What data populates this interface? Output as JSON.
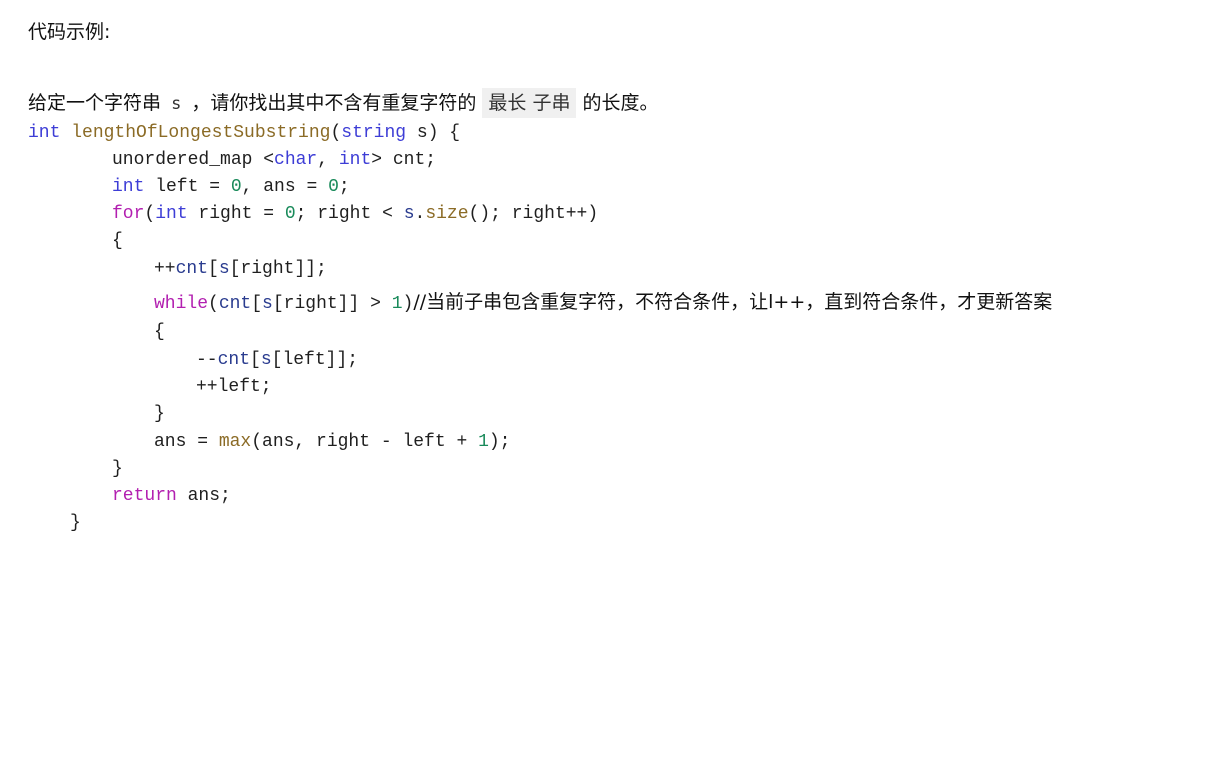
{
  "heading": "代码示例:",
  "problem": {
    "prefix": "给定一个字符串",
    "var": "s",
    "middle": "，请你找出其中不含有重复字符的",
    "highlight": "最长 子串",
    "suffix": "的长度。"
  },
  "code": {
    "l1": {
      "kw": "int",
      "fn": "lengthOfLongestSubstring",
      "open": "(",
      "type": "string",
      "rest": " s) {"
    },
    "l2": {
      "plain": "unordered_map <",
      "t1": "char",
      "comma": ", ",
      "t2": "int",
      "rest": "> cnt;"
    },
    "l3": {
      "kw": "int",
      "a": " left = ",
      "n1": "0",
      "b": ", ans = ",
      "n2": "0",
      "c": ";"
    },
    "l4": {
      "ctl": "for",
      "a": "(",
      "kw": "int",
      "b": " right = ",
      "n1": "0",
      "c": "; right < ",
      "v": "s",
      "d": ".",
      "fn": "size",
      "e": "(); right++)"
    },
    "l5": "{",
    "l6": {
      "a": "++",
      "v1": "cnt",
      "b": "[",
      "v2": "s",
      "c": "[right]];"
    },
    "l7": {
      "ctl": "while",
      "a": "(",
      "v1": "cnt",
      "b": "[",
      "v2": "s",
      "c": "[right]] > ",
      "n": "1",
      "d": ")",
      "comment": "//当前子串包含重复字符，不符合条件，让l++，直到符合条件，才更新答案"
    },
    "l8": "{",
    "l9": {
      "a": "--",
      "v1": "cnt",
      "b": "[",
      "v2": "s",
      "c": "[left]];"
    },
    "l10": "++left;",
    "l11": "}",
    "l12": {
      "a": "ans = ",
      "fn": "max",
      "b": "(ans, right - left + ",
      "n": "1",
      "c": ");"
    },
    "l13": "}",
    "l14": {
      "ctl": "return",
      "a": " ans;"
    },
    "l15": "}"
  }
}
